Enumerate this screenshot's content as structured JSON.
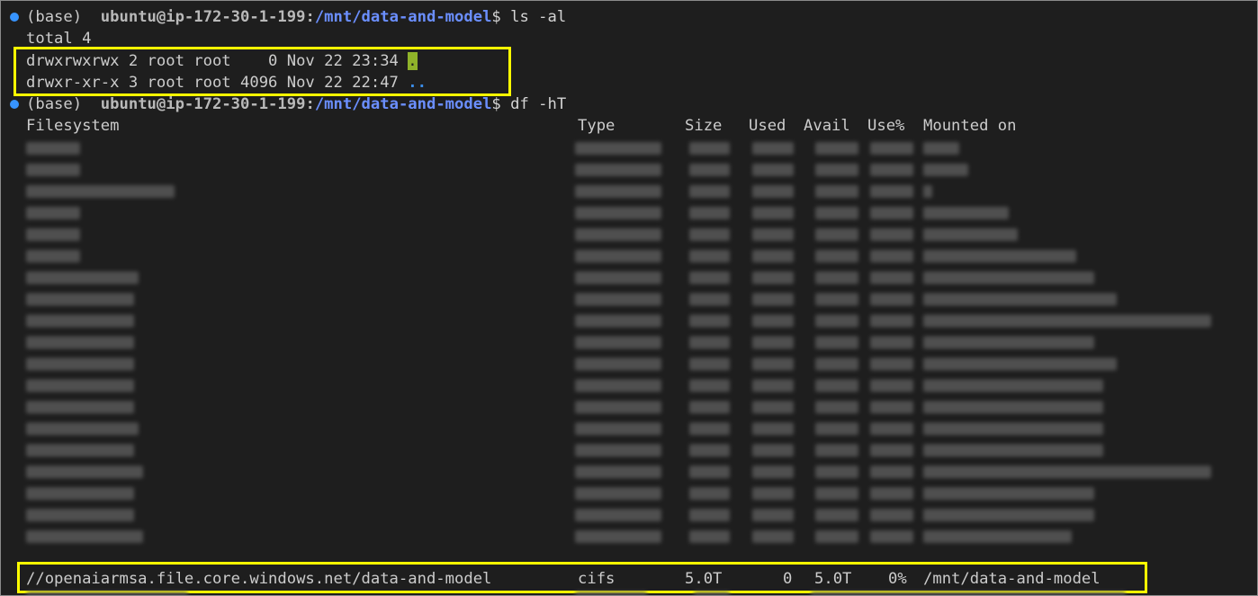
{
  "terminal": {
    "prompt1": {
      "env": "(base)",
      "user": "ubuntu@ip-172-30-1-199",
      "path": "/mnt/data-and-model",
      "command": "ls -al"
    },
    "ls_total": "total 4",
    "ls_rows": [
      {
        "perm_info": "drwxrwxrwx 2 root root    0 Nov 22 23:34 ",
        "name": "."
      },
      {
        "perm_info": "drwxr-xr-x 3 root root 4096 Nov 22 22:47 ",
        "name": ".."
      }
    ],
    "prompt2": {
      "env": "(base)",
      "user": "ubuntu@ip-172-30-1-199",
      "path": "/mnt/data-and-model",
      "command": "df -hT"
    },
    "df_headers": {
      "filesystem": "Filesystem",
      "type": "Type",
      "size": "Size",
      "used": "Used",
      "avail": "Avail",
      "use_pct": "Use%",
      "mounted_on": "Mounted on"
    },
    "df_highlight_row": {
      "filesystem": "//openaiarmsa.file.core.windows.net/data-and-model",
      "type": "cifs",
      "size": "5.0T",
      "used": "0",
      "avail": "5.0T",
      "use_pct": "0%",
      "mounted_on": "/mnt/data-and-model"
    }
  },
  "colors": {
    "background": "#1e1e1e",
    "path": "#6b8fff",
    "highlight_box": "#ffff00",
    "dot_dir_bg": "#8fb32a",
    "dotdot_dir": "#3b8eea"
  }
}
